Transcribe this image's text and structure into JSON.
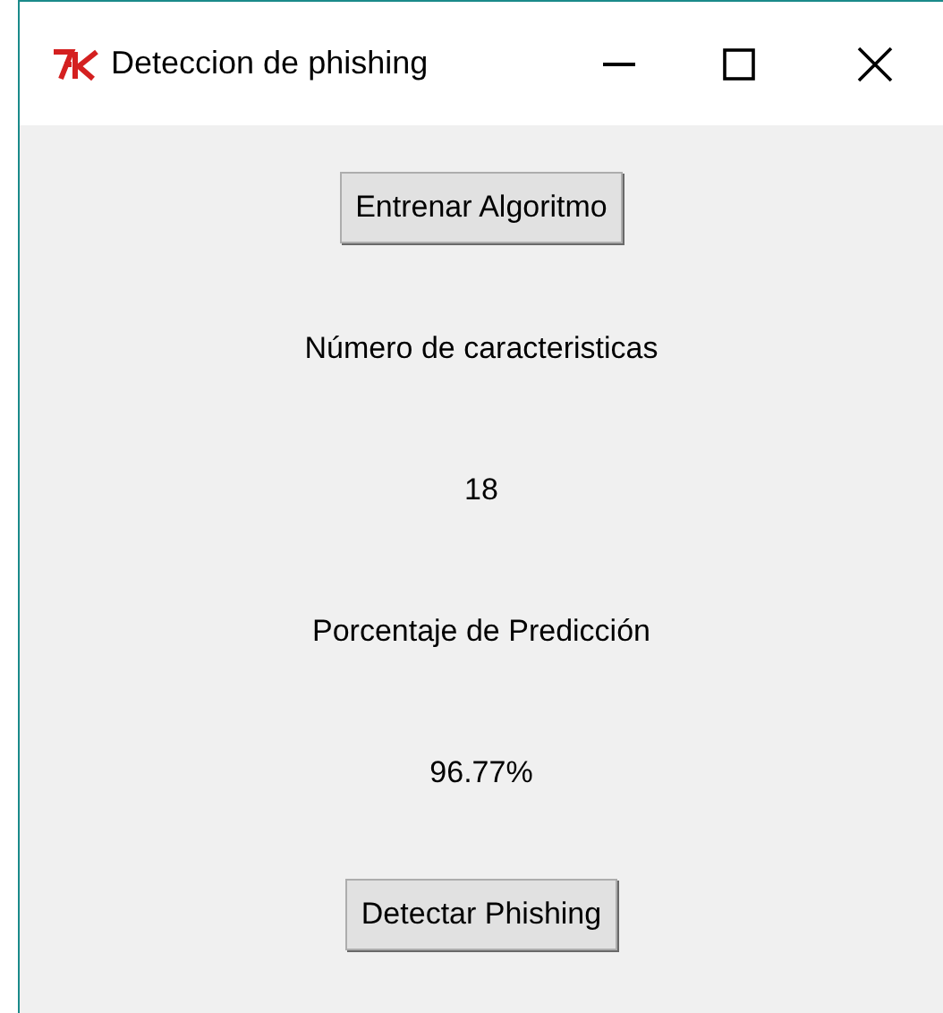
{
  "window": {
    "title": "Deteccion de phishing"
  },
  "content": [
    {
      "kind": "button",
      "text": "Entrenar Algoritmo"
    },
    {
      "kind": "label",
      "text": "Número de caracteristicas"
    },
    {
      "kind": "label",
      "text": "18"
    },
    {
      "kind": "label",
      "text": "Porcentaje de Predicción"
    },
    {
      "kind": "label",
      "text": "96.77%"
    },
    {
      "kind": "button",
      "text": "Detectar Phishing"
    }
  ]
}
